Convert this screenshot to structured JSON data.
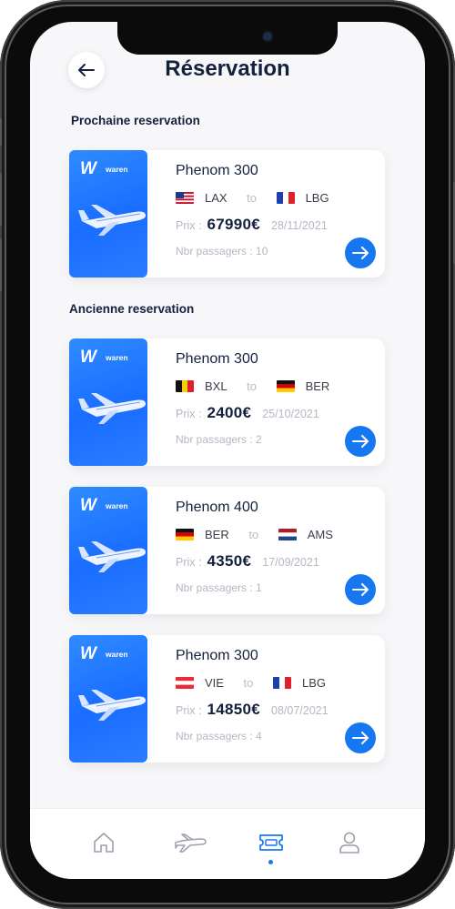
{
  "header": {
    "title": "Réservation"
  },
  "sections": {
    "upcoming": "Prochaine reservation",
    "past": "Ancienne reservation"
  },
  "brand": {
    "logo": "W",
    "name": "waren",
    "accent": "#1677f0"
  },
  "labels": {
    "to": "to",
    "price": "Prix :",
    "passengers_prefix": "Nbr passagers : "
  },
  "reservations": [
    {
      "plane": "Phenom 300",
      "from": "LAX",
      "from_flag": "us-flag-icon",
      "to": "LBG",
      "to_flag": "fr-flag-icon",
      "price": "67990€",
      "date": "28/11/2021",
      "passengers": "Nbr passagers : 10"
    },
    {
      "plane": "Phenom 300",
      "from": "BXL",
      "from_flag": "be-flag-icon",
      "to": "BER",
      "to_flag": "de-flag-icon",
      "price": "2400€",
      "date": "25/10/2021",
      "passengers": "Nbr passagers : 2"
    },
    {
      "plane": "Phenom 400",
      "from": "BER",
      "from_flag": "de-flag-icon",
      "to": "AMS",
      "to_flag": "nl-flag-icon",
      "price": "4350€",
      "date": "17/09/2021",
      "passengers": "Nbr passagers : 1"
    },
    {
      "plane": "Phenom 300",
      "from": "VIE",
      "from_flag": "at-flag-icon",
      "to": "LBG",
      "to_flag": "fr-flag-icon",
      "price": "14850€",
      "date": "08/07/2021",
      "passengers": "Nbr passagers : 4"
    }
  ],
  "tabbar": {
    "items": [
      "home-icon",
      "plane-icon",
      "ticket-icon",
      "profile-icon"
    ],
    "active": "ticket-icon"
  }
}
